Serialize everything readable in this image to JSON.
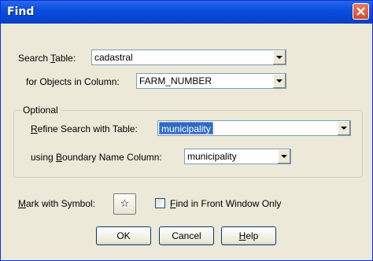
{
  "window": {
    "title": "Find"
  },
  "search_table": {
    "label_prefix": "Search ",
    "label_accel": "T",
    "label_suffix": "able:",
    "value": "cadastral"
  },
  "objects_column": {
    "label": "for Objects in Column:",
    "value": "FARM_NUMBER"
  },
  "optional_group": {
    "title": "Optional",
    "refine": {
      "label_accel": "R",
      "label_suffix": "efine Search with Table:",
      "value": "municipality"
    },
    "boundary": {
      "label_prefix": "using ",
      "label_accel": "B",
      "label_suffix": "oundary Name Column:",
      "value": "municipality"
    }
  },
  "mark_symbol": {
    "label_accel": "M",
    "label_suffix": "ark with Symbol:",
    "symbol": "☆"
  },
  "front_window": {
    "label_accel": "F",
    "label_suffix": "ind in Front Window Only",
    "checked": false
  },
  "buttons": {
    "ok": "OK",
    "cancel": "Cancel",
    "help_accel": "H",
    "help_suffix": "elp"
  }
}
